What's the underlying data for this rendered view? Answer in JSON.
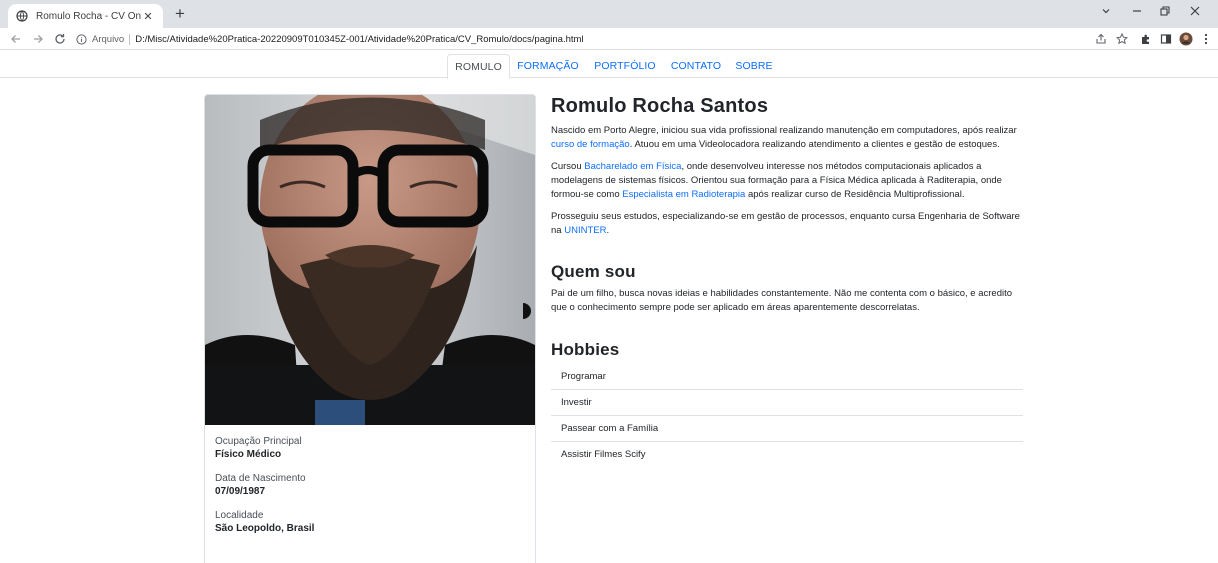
{
  "browser": {
    "tab_title": "Romulo Rocha - CV Online",
    "tab_close": "✕",
    "new_tab": "+",
    "security_label": "Arquivo",
    "url": "D:/Misc/Atividade%20Pratica-20220909T010345Z-001/Atividade%20Pratica/CV_Romulo/docs/pagina.html"
  },
  "nav": {
    "items": [
      "ROMULO",
      "FORMAÇÃO",
      "PORTFÓLIO",
      "CONTATO",
      "SOBRE"
    ],
    "active": "ROMULO"
  },
  "profile": {
    "fields": [
      {
        "label": "Ocupação Principal",
        "value": "Físico Médico"
      },
      {
        "label": "Data de Nascimento",
        "value": "07/09/1987"
      },
      {
        "label": "Localidade",
        "value": "São Leopoldo, Brasil"
      }
    ]
  },
  "about": {
    "name": "Romulo Rocha Santos",
    "p1": {
      "a": "Nascido em Porto Alegre, iniciou sua vida profissional realizando manutenção em computadores, após realizar ",
      "link": "curso de formação",
      "b": ". Atuou em uma Videolocadora realizando atendimento a clientes e gestão de estoques."
    },
    "p2": {
      "a": "Cursou ",
      "link1": "Bacharelado em Física",
      "b": ", onde desenvolveu interesse nos métodos computacionais aplicados a modelagens de sistemas físicos. Orientou sua formação para a Física Médica aplicada à Raditerapia, onde formou-se como ",
      "link2": "Especialista em Radioterapia",
      "c": " após realizar curso de Residência Multiprofissional."
    },
    "p3": {
      "a": "Prosseguiu seus estudos, especializando-se em gestão de processos, enquanto cursa Engenharia de Software na ",
      "link": "UNINTER",
      "b": "."
    }
  },
  "quem_sou": {
    "title": "Quem sou",
    "text": "Pai de um filho, busca novas ideias e habilidades constantemente. Não me contenta com o básico, e acredito que o conhecimento sempre pode ser aplicado em áreas aparentemente descorrelatas."
  },
  "hobbies": {
    "title": "Hobbies",
    "items": [
      "Programar",
      "Investir",
      "Passear com a Família",
      "Assistir Filmes Scify"
    ]
  },
  "colors": {
    "link": "#0d6efd",
    "border": "#dee2e6",
    "tabstrip": "#dee1e6"
  }
}
